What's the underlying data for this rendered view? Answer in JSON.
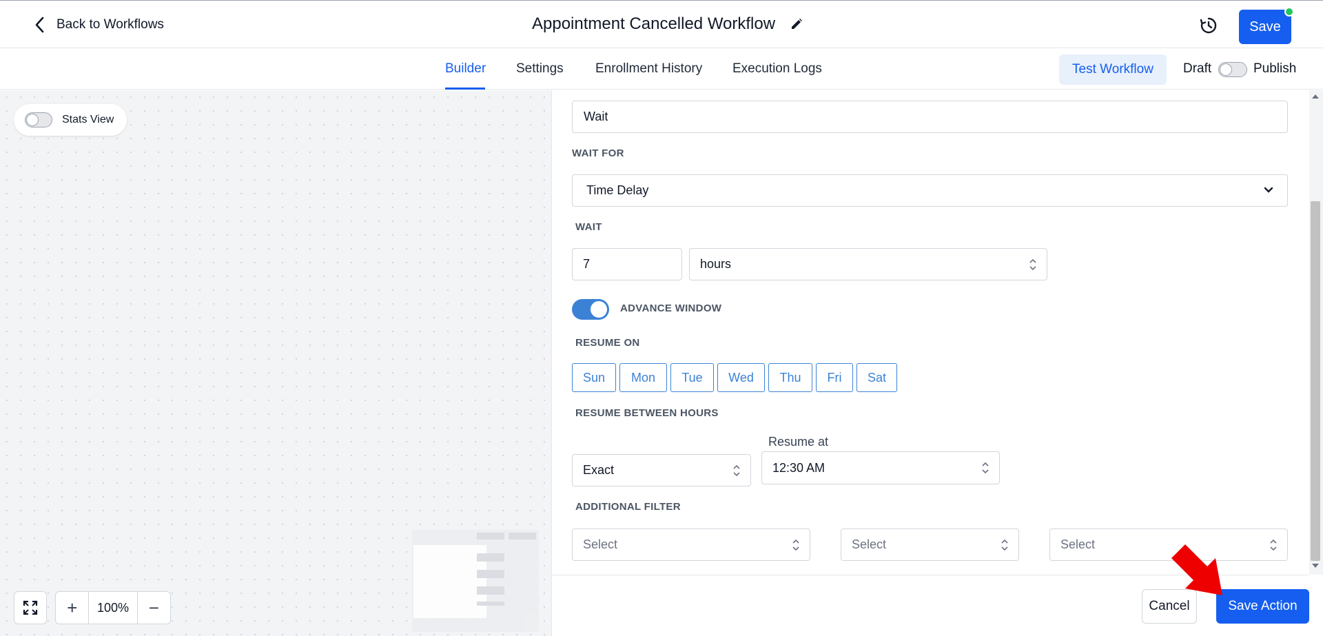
{
  "header": {
    "back_label": "Back to Workflows",
    "title": "Appointment Cancelled Workflow",
    "save_label": "Save"
  },
  "tabs": [
    {
      "label": "Builder",
      "active": true
    },
    {
      "label": "Settings",
      "active": false
    },
    {
      "label": "Enrollment History",
      "active": false
    },
    {
      "label": "Execution Logs",
      "active": false
    }
  ],
  "toolbar": {
    "test_workflow_label": "Test Workflow",
    "draft_label": "Draft",
    "publish_label": "Publish",
    "publish_on": false
  },
  "canvas": {
    "stats_view_label": "Stats View",
    "stats_view_on": false,
    "zoom_level": "100%",
    "zoom_in_symbol": "+",
    "zoom_out_symbol": "−"
  },
  "form": {
    "action_name_value": "Wait",
    "wait_for_label": "WAIT FOR",
    "wait_for_value": "Time Delay",
    "wait_label": "WAIT",
    "wait_amount": "7",
    "wait_unit": "hours",
    "advance_window_label": "ADVANCE WINDOW",
    "advance_window_on": true,
    "resume_on_label": "RESUME ON",
    "days": [
      "Sun",
      "Mon",
      "Tue",
      "Wed",
      "Thu",
      "Fri",
      "Sat"
    ],
    "resume_between_hours_label": "RESUME BETWEEN HOURS",
    "resume_mode_value": "Exact",
    "resume_at_label": "Resume at",
    "resume_at_value": "12:30 AM",
    "additional_filter_label": "ADDITIONAL FILTER",
    "filter_placeholders": [
      "Select",
      "Select",
      "Select"
    ]
  },
  "footer": {
    "cancel_label": "Cancel",
    "save_action_label": "Save Action"
  },
  "colors": {
    "primary": "#155eef",
    "toggle_on": "#3b82d6",
    "annotation_arrow": "#ee0000",
    "status_dot": "#22c55e"
  }
}
